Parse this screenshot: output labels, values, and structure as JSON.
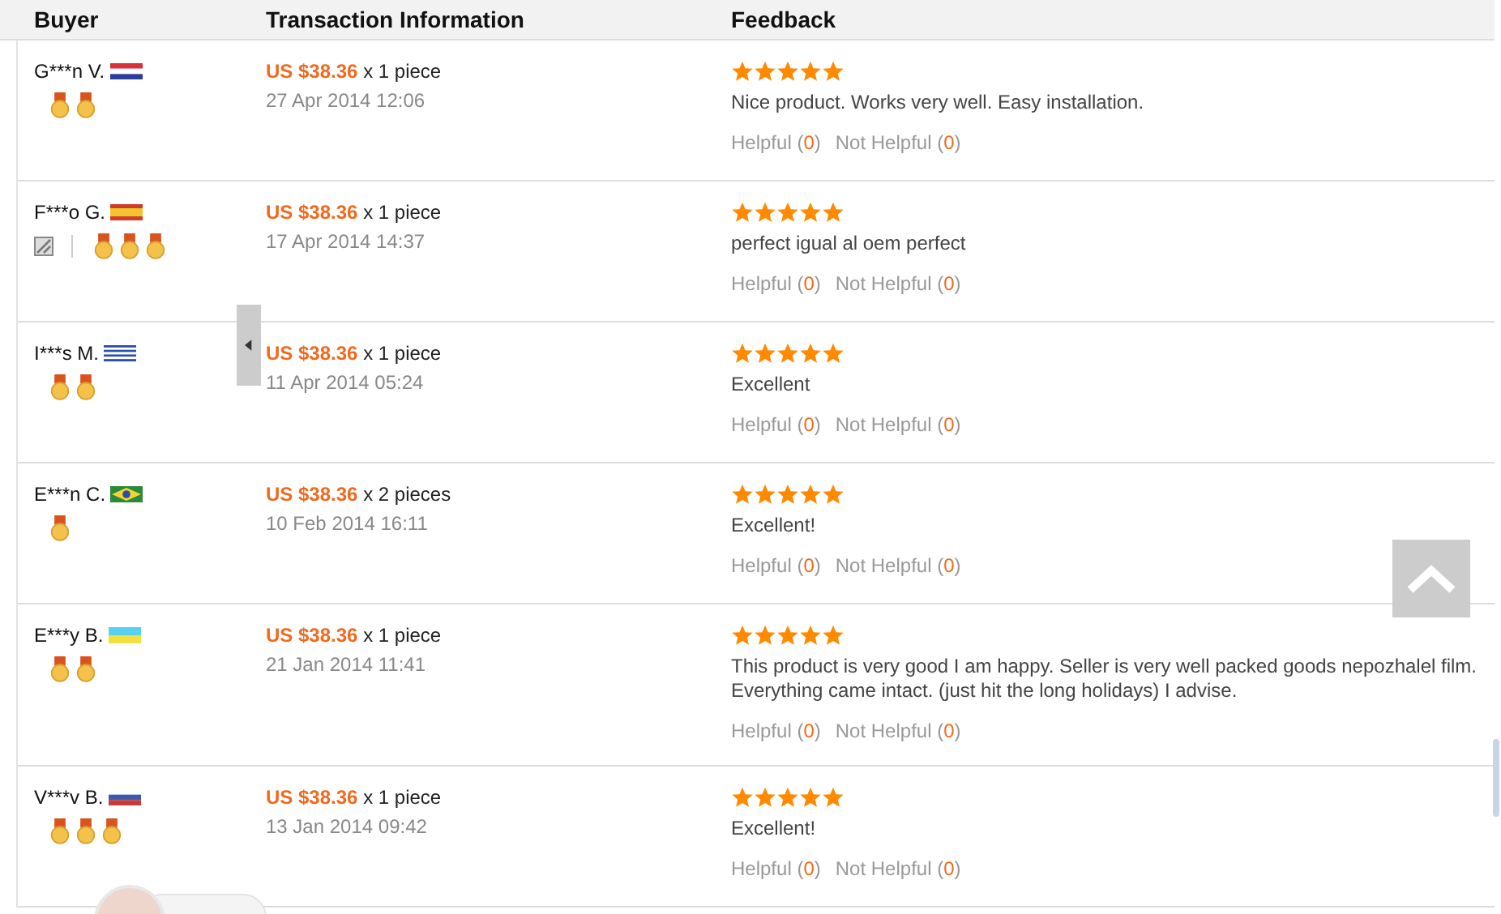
{
  "table": {
    "columns": [
      "Buyer",
      "Transaction Information",
      "Feedback"
    ],
    "rows": [
      {
        "buyer": "G***n V.",
        "badges": [
          {
            "kind": "medal"
          },
          {
            "kind": "medal"
          }
        ],
        "price": "US $38.36",
        "quantity": "x 1 piece",
        "date": "27 Apr 2014 12:06",
        "stars": 5,
        "comment": "Nice product. Works very well. Easy installation.",
        "helpful": {
          "label": "Helpful (",
          "count": "0",
          "close": ")"
        },
        "not_helpful": {
          "label": "Not Helpful (",
          "count": "0",
          "close": ")"
        }
      },
      {
        "buyer": "F***o G.",
        "badges": [
          {
            "kind": "photo"
          },
          {
            "kind": "medal"
          },
          {
            "kind": "medal"
          },
          {
            "kind": "medal"
          }
        ],
        "price": "US $38.36",
        "quantity": "x 1 piece",
        "date": "17 Apr 2014 14:37",
        "stars": 5,
        "comment": "perfect igual al oem perfect",
        "helpful": {
          "label": "Helpful (",
          "count": "0",
          "close": ")"
        },
        "not_helpful": {
          "label": "Not Helpful (",
          "count": "0",
          "close": ")"
        }
      },
      {
        "buyer": "I***s M.",
        "badges": [
          {
            "kind": "medal"
          },
          {
            "kind": "medal"
          }
        ],
        "price": "US $38.36",
        "quantity": "x 1 piece",
        "date": "11 Apr 2014 05:24",
        "stars": 5,
        "comment": "Excellent",
        "helpful": {
          "label": "Helpful (",
          "count": "0",
          "close": ")"
        },
        "not_helpful": {
          "label": "Not Helpful (",
          "count": "0",
          "close": ")"
        }
      },
      {
        "buyer": "E***n C.",
        "badges": [
          {
            "kind": "medal"
          }
        ],
        "price": "US $38.36",
        "quantity": "x 2 pieces",
        "date": "10 Feb 2014 16:11",
        "stars": 5,
        "comment": "Excellent!",
        "helpful": {
          "label": "Helpful (",
          "count": "0",
          "close": ")"
        },
        "not_helpful": {
          "label": "Not Helpful (",
          "count": "0",
          "close": ")"
        }
      },
      {
        "buyer": "E***y B.",
        "badges": [
          {
            "kind": "medal"
          },
          {
            "kind": "medal"
          }
        ],
        "price": "US $38.36",
        "quantity": "x 1 piece",
        "date": "21 Jan 2014 11:41",
        "stars": 5,
        "comment": "This product is very good I am happy. Seller is very well packed goods nepozhalel film. Everything came intact. (just hit the long holidays) I advise.",
        "helpful": {
          "label": "Helpful (",
          "count": "0",
          "close": ")"
        },
        "not_helpful": {
          "label": "Not Helpful (",
          "count": "0",
          "close": ")"
        }
      },
      {
        "buyer": "V***v B.",
        "badges": [
          {
            "kind": "medal"
          },
          {
            "kind": "medal"
          },
          {
            "kind": "medal"
          }
        ],
        "price": "US $38.36",
        "quantity": "x 1 piece",
        "date": "13 Jan 2014 09:42",
        "stars": 5,
        "comment": "Excellent!",
        "helpful": {
          "label": "Helpful (",
          "count": "0",
          "close": ")"
        },
        "not_helpful": {
          "label": "Not Helpful (",
          "count": "0",
          "close": ")"
        }
      }
    ]
  }
}
